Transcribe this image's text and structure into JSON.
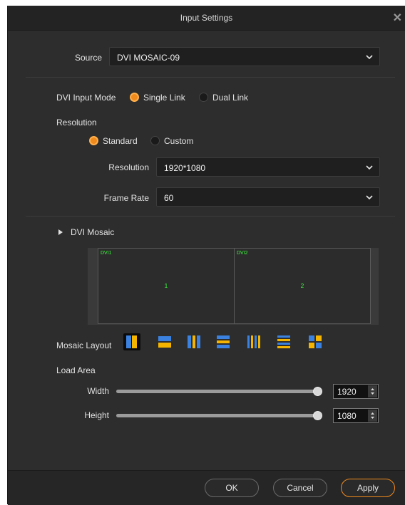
{
  "dialog": {
    "title": "Input Settings"
  },
  "source": {
    "label": "Source",
    "value": "DVI MOSAIC-09"
  },
  "dvi_input_mode": {
    "label": "DVI Input Mode",
    "options": [
      "Single Link",
      "Dual Link"
    ],
    "selected": "Single Link"
  },
  "resolution_section": {
    "heading": "Resolution",
    "options": [
      "Standard",
      "Custom"
    ],
    "selected": "Standard",
    "resolution_label": "Resolution",
    "resolution_value": "1920*1080",
    "frame_rate_label": "Frame Rate",
    "frame_rate_value": "60"
  },
  "mosaic": {
    "heading": "DVI Mosaic",
    "cells": [
      {
        "tag": "DVI1",
        "number": "1"
      },
      {
        "tag": "DVI2",
        "number": "2"
      }
    ],
    "layout_label": "Mosaic Layout",
    "layouts": [
      "2-columns",
      "2-rows",
      "3-columns",
      "3-rows",
      "4-columns",
      "4-rows",
      "2x2-grid"
    ],
    "selected_layout": "2-columns"
  },
  "load_area": {
    "heading": "Load Area",
    "width_label": "Width",
    "width_value": "1920",
    "width_fraction": 1.0,
    "height_label": "Height",
    "height_value": "1080",
    "height_fraction": 1.0
  },
  "footer": {
    "ok": "OK",
    "cancel": "Cancel",
    "apply": "Apply"
  },
  "colors": {
    "accent": "#f08a1c",
    "layout_blue": "#3b82e0",
    "layout_yellow": "#f4b400",
    "mosaic_text": "#3cff3c"
  }
}
